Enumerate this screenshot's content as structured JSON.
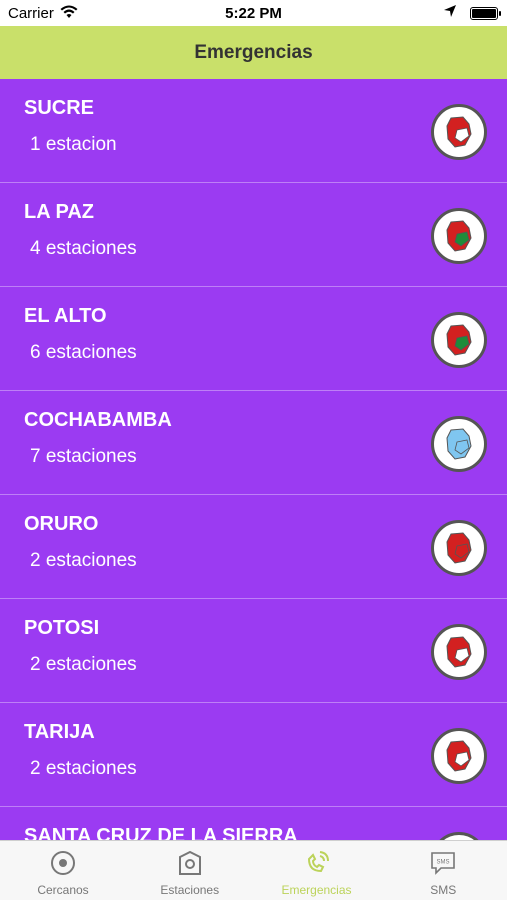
{
  "status_bar": {
    "carrier": "Carrier",
    "time": "5:22 PM"
  },
  "nav": {
    "title": "Emergencias"
  },
  "rows": [
    {
      "name": "SUCRE",
      "count": "1 estacion",
      "colors": [
        "#d32020",
        "#ffffff"
      ]
    },
    {
      "name": "LA PAZ",
      "count": "4 estaciones",
      "colors": [
        "#d32020",
        "#1e8c3a"
      ]
    },
    {
      "name": "EL ALTO",
      "count": "6 estaciones",
      "colors": [
        "#d32020",
        "#1e8c3a"
      ]
    },
    {
      "name": "COCHABAMBA",
      "count": "7 estaciones",
      "colors": [
        "#7fc6f0",
        "#7fc6f0"
      ]
    },
    {
      "name": "ORURO",
      "count": "2 estaciones",
      "colors": [
        "#d32020",
        "#d32020"
      ]
    },
    {
      "name": "POTOSI",
      "count": "2 estaciones",
      "colors": [
        "#d32020",
        "#ffffff"
      ]
    },
    {
      "name": "TARIJA",
      "count": "2 estaciones",
      "colors": [
        "#d32020",
        "#ffffff"
      ]
    },
    {
      "name": "SANTA CRUZ DE LA SIERRA",
      "count": "",
      "colors": [
        "#1e8c3a",
        "#ffffff"
      ]
    }
  ],
  "tabs": [
    {
      "label": "Cercanos",
      "icon": "target-icon"
    },
    {
      "label": "Estaciones",
      "icon": "station-icon"
    },
    {
      "label": "Emergencias",
      "icon": "phone-ring-icon",
      "active": true
    },
    {
      "label": "SMS",
      "icon": "sms-icon"
    }
  ],
  "theme": {
    "nav_bg": "#c9e06a",
    "list_bg": "#9b3bf2",
    "active_tab": "#bcd35a"
  }
}
